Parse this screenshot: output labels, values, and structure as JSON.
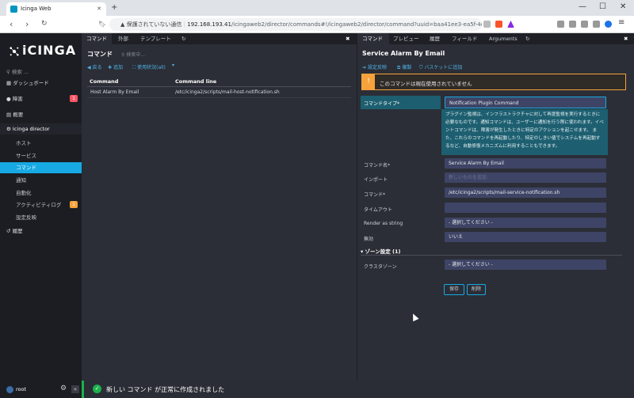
{
  "browser": {
    "tab_title": "Icinga Web",
    "security_warning": "保護されていない通信",
    "url_host": "192.168.193.41",
    "url_path": "/icingaweb2/director/commands#!/icingaweb2/director/command?uuid=baa41ee3-ea5f-4dc5-b11..."
  },
  "sidebar": {
    "logo_text": "iCINGA",
    "search_placeholder": "検索 ...",
    "items": [
      {
        "label": "ダッシュボード",
        "icon": "dashboard-icon"
      },
      {
        "label": "障害",
        "icon": "alert-icon",
        "badge": "1",
        "badge_color": "#ff5566"
      },
      {
        "label": "概要",
        "icon": "overview-icon"
      },
      {
        "label": "Icinga director",
        "icon": "director-icon"
      },
      {
        "label": "ホスト"
      },
      {
        "label": "サービス"
      },
      {
        "label": "コマンド",
        "active": true
      },
      {
        "label": "通知"
      },
      {
        "label": "自動化"
      },
      {
        "label": "アクティビティログ",
        "badge": "1",
        "badge_color": "#f7a23b"
      },
      {
        "label": "設定反映"
      },
      {
        "label": "履歴",
        "icon": "history-icon"
      }
    ],
    "user": "root"
  },
  "left_pane": {
    "tabs": [
      "コマンド",
      "外部",
      "テンプレート"
    ],
    "title": "コマンド",
    "search_placeholder": "検索中...",
    "actions": [
      "戻る",
      "追加",
      "使用状況(all)"
    ],
    "columns": [
      "Command",
      "Command line"
    ],
    "rows": [
      {
        "command": "Host Alarm By Email",
        "command_line": "/etc/icinga2/scripts/mail-host-notification.sh"
      }
    ]
  },
  "right_pane": {
    "tabs": [
      "コマンド",
      "プレビュー",
      "履歴",
      "フィールド",
      "Arguments"
    ],
    "title": "Service Alarm By Email",
    "actions": [
      "設定反映",
      "複製",
      "バスケットに追加"
    ],
    "warning": "このコマンドは現在使用されていません",
    "form": {
      "command_type_label": "コマンドタイプ*",
      "command_type_value": "Notification Plugin Command",
      "command_type_help": "プラグイン監視は、インフラストラクチャに対して再度監視を実行するときに必要なものです。通知コマンドは、ユーザーに通知を行う際に使われます。イベントコマンドは、障害が発生したときに特定のアクションを起こせます。 また、これらのコマンドを再起動したり、特定のしきい値でシステムを再起動するなど、自動修復メカニズムに利用することもできます。",
      "name_label": "コマンド名*",
      "name_value": "Service Alarm By Email",
      "import_label": "インポート",
      "import_placeholder": "新しいものを追加",
      "command_label": "コマンド*",
      "command_value": "/etc/icinga2/scripts/mail-service-notification.sh",
      "timeout_label": "タイムアウト",
      "timeout_value": "",
      "render_label": "Render as string",
      "render_value": "- 選択してください -",
      "disabled_label": "無効",
      "disabled_value": "いいえ",
      "zone_section": "ゾーン設定 (1)",
      "cluster_zone_label": "クラスタゾーン",
      "cluster_zone_value": "- 選択してください -"
    },
    "buttons": {
      "save": "保存",
      "delete": "削除"
    }
  },
  "toast": {
    "message": "新しい コマンド が正常に作成されました"
  },
  "colors": {
    "accent": "#16a9e3",
    "success": "#1bb24a",
    "warning": "#f7a23b"
  }
}
